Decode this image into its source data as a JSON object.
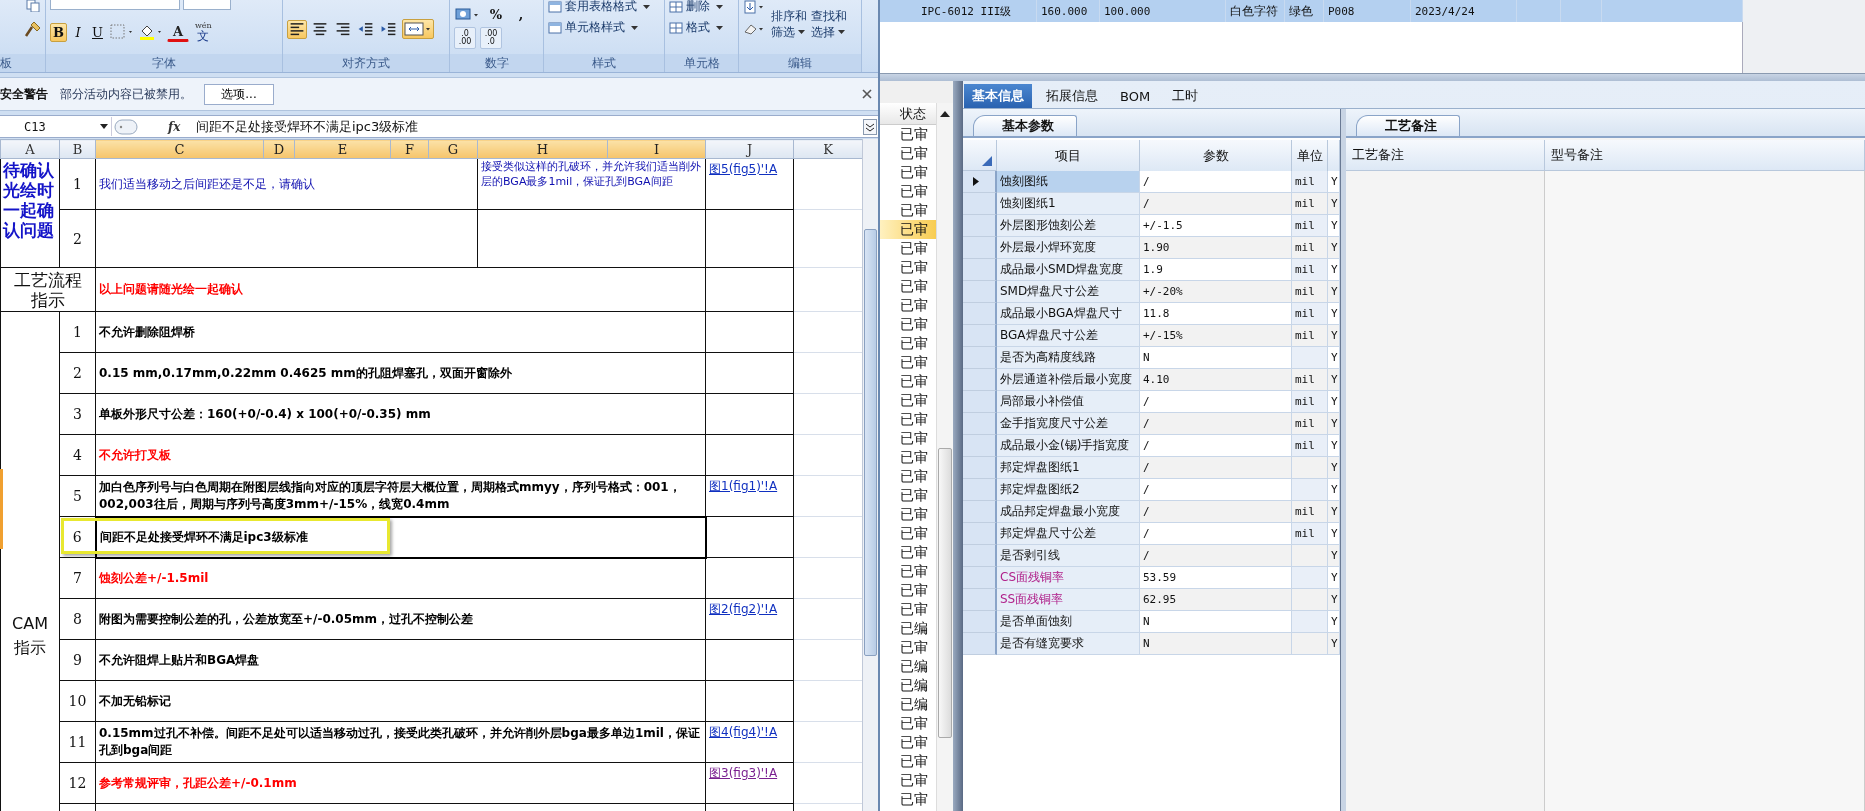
{
  "excel": {
    "ribbon": {
      "groups": [
        {
          "label": "板"
        },
        {
          "label": "字体"
        },
        {
          "label": "对齐方式"
        },
        {
          "label": "数字"
        },
        {
          "label": "样式"
        },
        {
          "label": "单元格"
        },
        {
          "label": "编辑"
        }
      ],
      "font_buttons": [
        {
          "text": "B",
          "on": true
        },
        {
          "text": "I",
          "on": false
        },
        {
          "text": "U",
          "on": false
        }
      ],
      "font_color_letter": "A",
      "phonetic": {
        "top": "wén",
        "main": "文"
      },
      "align_buttons": [
        {
          "kind": "left",
          "on": true
        },
        {
          "kind": "center",
          "on": false
        },
        {
          "kind": "right",
          "on": false
        },
        {
          "kind": "outdent",
          "on": false
        },
        {
          "kind": "indent",
          "on": false
        }
      ],
      "merge_on": true,
      "number_symbols": [
        "%",
        ","
      ],
      "decimal_buttons": [
        {
          "upper": ".0",
          "lower": ".00"
        },
        {
          "upper": ".00",
          "lower": ".0"
        }
      ],
      "style_commands": [
        "套用表格格式",
        "单元格样式"
      ],
      "cell_commands": [
        "删除",
        "格式"
      ],
      "edit_commands": [
        {
          "line1": "排序和",
          "line2": "筛选"
        },
        {
          "line1": "查找和",
          "line2": "选择"
        }
      ]
    },
    "security_bar": {
      "title": "安全警告",
      "message": "部分活动内容已被禁用。",
      "button": "选项..."
    },
    "formula_bar": {
      "name_box": "C13",
      "fx": "fx",
      "value": "间距不足处接受焊环不满足ipc3级标准"
    },
    "sheet": {
      "columns": [
        {
          "label": "A",
          "selected": false
        },
        {
          "label": "B",
          "selected": false
        },
        {
          "label": "C",
          "selected": true
        },
        {
          "label": "D",
          "selected": true
        },
        {
          "label": "E",
          "selected": true
        },
        {
          "label": "F",
          "selected": true
        },
        {
          "label": "G",
          "selected": true
        },
        {
          "label": "H",
          "selected": true
        },
        {
          "label": "I",
          "selected": true
        },
        {
          "label": "J",
          "selected": false
        },
        {
          "label": "K",
          "selected": false
        }
      ],
      "confirm": {
        "label": "待确认光绘时一起确认问题",
        "rows": [
          {
            "no": "1",
            "text": "我们适当移动之后间距还是不足，请确认",
            "note": "接受类似这样的孔破环，并允许我们适当削外层的BGA最多1mil，保证孔到BGA间距",
            "link": {
              "text": "图5(fig5)'!A",
              "visited": false
            }
          },
          {
            "no": "2"
          }
        ]
      },
      "flow": {
        "label": "工艺流程指示",
        "text": "以上问题请随光绘一起确认",
        "color": "#ff0000"
      },
      "cam": {
        "label_lines": [
          "CAM",
          "指示"
        ],
        "items": [
          {
            "no": "1",
            "text": "不允许删除阻焊桥",
            "color": "#000000",
            "selected": false
          },
          {
            "no": "2",
            "text": "0.15 mm,0.17mm,0.22mm 0.4625 mm的孔阻焊塞孔，双面开窗除外",
            "color": "#000000",
            "selected": false
          },
          {
            "no": "3",
            "text": "单板外形尺寸公差：160(+0/-0.4) x 100(+0/-0.35) mm",
            "color": "#000000",
            "selected": false
          },
          {
            "no": "4",
            "text": "不允许打叉板",
            "color": "#ff0000",
            "selected": false
          },
          {
            "no": "5",
            "text": "加白色序列号与白色周期在附图层线指向对应的顶层字符层大概位置，周期格式mmyy，序列号格式：001，002,003往后，周期与序列号高度3mm+/-15%，线宽0.4mm",
            "color": "#000000",
            "selected": false,
            "link": {
              "text": "图1(fig1)'!A",
              "visited": false
            }
          },
          {
            "no": "6",
            "text": "间距不足处接受焊环不满足ipc3级标准",
            "color": "#000000",
            "selected": true
          },
          {
            "no": "7",
            "text": "蚀刻公差+/-1.5mil",
            "color": "#ff0000",
            "selected": false
          },
          {
            "no": "8",
            "text": "附图为需要控制公差的孔，公差放宽至+/-0.05mm，过孔不控制公差",
            "color": "#000000",
            "selected": false,
            "link": {
              "text": "图2(fig2)'!A",
              "visited": false
            }
          },
          {
            "no": "9",
            "text": "不允许阻焊上贴片和BGA焊盘",
            "color": "#000000",
            "selected": false
          },
          {
            "no": "10",
            "text": "不加无铅标记",
            "color": "#000000",
            "selected": false
          },
          {
            "no": "11",
            "text": "0.15mm过孔不补偿。间距不足处可以适当移动过孔，接受此类孔破环，并允许削外层bga最多单边1mil，保证孔到bga间距",
            "color": "#000000",
            "selected": false,
            "link": {
              "text": "图4(fig4)'!A",
              "visited": false
            }
          },
          {
            "no": "12",
            "text": "参考常规评审，孔距公差+/-0.1mm",
            "color": "#ff0000",
            "selected": false,
            "link": {
              "text": "图3(fig3)'!A",
              "visited": true
            }
          }
        ]
      }
    }
  },
  "record": {
    "selected": true,
    "cells": [
      "IPC-6012 III级",
      "160.000",
      "100.000",
      "白色字符",
      "绿色",
      "P008",
      "2023/4/24"
    ]
  },
  "status_list": {
    "header": "状态",
    "items": [
      {
        "text": "已审",
        "selected": false
      },
      {
        "text": "已审",
        "selected": false
      },
      {
        "text": "已审",
        "selected": false
      },
      {
        "text": "已审",
        "selected": false
      },
      {
        "text": "已审",
        "selected": false
      },
      {
        "text": "已审",
        "selected": true
      },
      {
        "text": "已审",
        "selected": false
      },
      {
        "text": "已审",
        "selected": false
      },
      {
        "text": "已审",
        "selected": false
      },
      {
        "text": "已审",
        "selected": false
      },
      {
        "text": "已审",
        "selected": false
      },
      {
        "text": "已审",
        "selected": false
      },
      {
        "text": "已审",
        "selected": false
      },
      {
        "text": "已审",
        "selected": false
      },
      {
        "text": "已审",
        "selected": false
      },
      {
        "text": "已审",
        "selected": false
      },
      {
        "text": "已审",
        "selected": false
      },
      {
        "text": "已审",
        "selected": false
      },
      {
        "text": "已审",
        "selected": false
      },
      {
        "text": "已审",
        "selected": false
      },
      {
        "text": "已审",
        "selected": false
      },
      {
        "text": "已审",
        "selected": false
      },
      {
        "text": "已审",
        "selected": false
      },
      {
        "text": "已审",
        "selected": false
      },
      {
        "text": "已审",
        "selected": false
      },
      {
        "text": "已审",
        "selected": false
      },
      {
        "text": "已编",
        "selected": false
      },
      {
        "text": "已审",
        "selected": false
      },
      {
        "text": "已编",
        "selected": false
      },
      {
        "text": "已编",
        "selected": false
      },
      {
        "text": "已编",
        "selected": false
      },
      {
        "text": "已审",
        "selected": false
      },
      {
        "text": "已审",
        "selected": false
      },
      {
        "text": "已审",
        "selected": false
      },
      {
        "text": "已审",
        "selected": false
      },
      {
        "text": "已审",
        "selected": false
      }
    ]
  },
  "tabs": [
    {
      "label": "基本信息",
      "selected": true
    },
    {
      "label": "拓展信息",
      "selected": false
    },
    {
      "label": "BOM",
      "selected": false
    },
    {
      "label": "工时",
      "selected": false
    }
  ],
  "basic_params": {
    "tab": "基本参数",
    "columns": [
      "项目",
      "参数",
      "单位"
    ],
    "rows": [
      {
        "item": "蚀刻图纸",
        "value": "/",
        "unit": "mil",
        "flag": "Y",
        "selected": true
      },
      {
        "item": "蚀刻图纸1",
        "value": "/",
        "unit": "mil",
        "flag": "Y",
        "selected": false
      },
      {
        "item": "外层图形蚀刻公差",
        "value": "+/-1.5",
        "unit": "mil",
        "flag": "Y",
        "selected": false
      },
      {
        "item": "外层最小焊环宽度",
        "value": "1.90",
        "unit": "mil",
        "flag": "Y",
        "selected": false
      },
      {
        "item": "成品最小SMD焊盘宽度",
        "value": "1.9",
        "unit": "mil",
        "flag": "Y",
        "selected": false
      },
      {
        "item": "SMD焊盘尺寸公差",
        "value": "+/-20%",
        "unit": "mil",
        "flag": "Y",
        "selected": false
      },
      {
        "item": "成品最小BGA焊盘尺寸",
        "value": "11.8",
        "unit": "mil",
        "flag": "Y",
        "selected": false
      },
      {
        "item": "BGA焊盘尺寸公差",
        "value": "+/-15%",
        "unit": "mil",
        "flag": "Y",
        "selected": false
      },
      {
        "item": "是否为高精度线路",
        "value": "N",
        "flag": "Y",
        "selected": false
      },
      {
        "item": "外层通道补偿后最小宽度",
        "value": "4.10",
        "unit": "mil",
        "flag": "Y",
        "selected": false
      },
      {
        "item": "局部最小补偿值",
        "value": "/",
        "unit": "mil",
        "flag": "Y",
        "selected": false
      },
      {
        "item": "金手指宽度尺寸公差",
        "value": "/",
        "unit": "mil",
        "flag": "Y",
        "selected": false
      },
      {
        "item": "成品最小金(锡)手指宽度",
        "value": "/",
        "unit": "mil",
        "flag": "Y",
        "selected": false
      },
      {
        "item": "邦定焊盘图纸1",
        "value": "/",
        "flag": "Y",
        "selected": false
      },
      {
        "item": "邦定焊盘图纸2",
        "value": "/",
        "flag": "Y",
        "selected": false
      },
      {
        "item": "成品邦定焊盘最小宽度",
        "value": "/",
        "unit": "mil",
        "flag": "Y",
        "selected": false
      },
      {
        "item": "邦定焊盘尺寸公差",
        "value": "/",
        "unit": "mil",
        "flag": "Y",
        "selected": false
      },
      {
        "item": "是否剥引线",
        "value": "/",
        "flag": "Y",
        "selected": false
      },
      {
        "item": "CS面残铜率",
        "value": "53.59",
        "flag": "Y",
        "selected": false,
        "color": "#b0208a"
      },
      {
        "item": "SS面残铜率",
        "value": "62.95",
        "flag": "Y",
        "selected": false,
        "color": "#b0208a"
      },
      {
        "item": "是否单面蚀刻",
        "value": "N",
        "flag": "Y",
        "selected": false
      },
      {
        "item": "是否有缝宽要求",
        "value": "N",
        "flag": "Y",
        "selected": false
      }
    ]
  },
  "process_notes": {
    "tab": "工艺备注",
    "columns": [
      "工艺备注",
      "型号备注"
    ]
  }
}
